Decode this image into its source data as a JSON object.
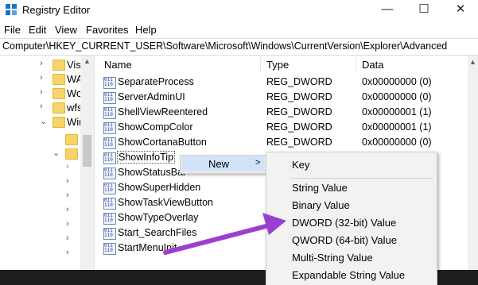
{
  "window": {
    "title": "Registry Editor",
    "minimize_glyph": "—",
    "maximize_glyph": "☐",
    "close_glyph": "✕"
  },
  "menu": [
    "File",
    "Edit",
    "View",
    "Favorites",
    "Help"
  ],
  "address": "Computer\\HKEY_CURRENT_USER\\Software\\Microsoft\\Windows\\CurrentVersion\\Explorer\\Advanced",
  "tree": {
    "items": [
      {
        "label": "Vis"
      },
      {
        "label": "WA"
      },
      {
        "label": "Wo"
      },
      {
        "label": "wfs"
      },
      {
        "label": "Win"
      }
    ]
  },
  "list": {
    "columns": [
      "Name",
      "Type",
      "Data"
    ],
    "rows": [
      {
        "name": "SeparateProcess",
        "type": "REG_DWORD",
        "data": "0x00000000 (0)"
      },
      {
        "name": "ServerAdminUI",
        "type": "REG_DWORD",
        "data": "0x00000000 (0)"
      },
      {
        "name": "ShellViewReentered",
        "type": "REG_DWORD",
        "data": "0x00000001 (1)"
      },
      {
        "name": "ShowCompColor",
        "type": "REG_DWORD",
        "data": "0x00000001 (1)"
      },
      {
        "name": "ShowCortanaButton",
        "type": "REG_DWORD",
        "data": "0x00000000 (0)"
      },
      {
        "name": "ShowInfoTip",
        "type": "",
        "data": ""
      },
      {
        "name": "ShowStatusBar",
        "type": "",
        "data": ""
      },
      {
        "name": "ShowSuperHidden",
        "type": "",
        "data": ""
      },
      {
        "name": "ShowTaskViewButton",
        "type": "",
        "data": ""
      },
      {
        "name": "ShowTypeOverlay",
        "type": "",
        "data": ""
      },
      {
        "name": "Start_SearchFiles",
        "type": "",
        "data": ""
      },
      {
        "name": "StartMenuInit",
        "type": "",
        "data": ""
      }
    ]
  },
  "context_menu": {
    "new_label": "New",
    "submenu_arrow": ">",
    "submenu": {
      "key": "Key",
      "items": [
        "String Value",
        "Binary Value",
        "DWORD (32-bit) Value",
        "QWORD (64-bit) Value",
        "Multi-String Value",
        "Expandable String Value"
      ]
    }
  },
  "icons": {
    "app": "registry-editor-icon",
    "value": "reg-binary-value-icon",
    "folder": "folder-icon",
    "annotation": "purple-arrow"
  },
  "colors": {
    "annotation_arrow": "#9b3fd1",
    "menu_highlight": "#cfe2f8",
    "folder": "#f7d467"
  }
}
